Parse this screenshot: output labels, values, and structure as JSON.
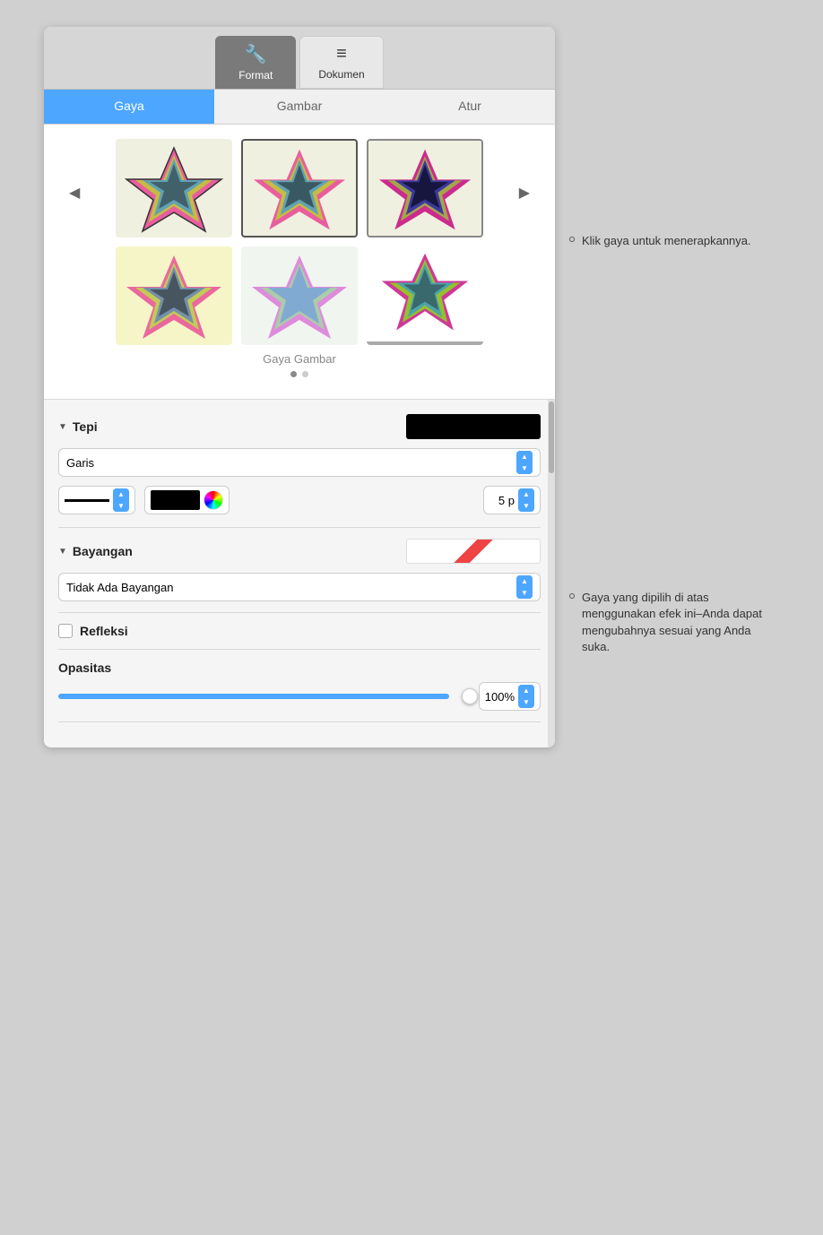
{
  "toolbar": {
    "format_label": "Format",
    "dokumen_label": "Dokumen",
    "format_icon": "🔧",
    "dokumen_icon": "≡"
  },
  "tabs": {
    "gaya_label": "Gaya",
    "gambar_label": "Gambar",
    "atur_label": "Atur"
  },
  "styles": {
    "section_label": "Gaya Gambar",
    "page_dot1_active": true,
    "page_dot2_active": false
  },
  "tepi": {
    "title": "Tepi",
    "border_type_label": "Garis",
    "size_value": "5 p"
  },
  "bayangan": {
    "title": "Bayangan",
    "type_label": "Tidak Ada Bayangan"
  },
  "refleksi": {
    "label": "Refleksi",
    "checked": false
  },
  "opasitas": {
    "title": "Opasitas",
    "value": "100%",
    "percent": 100
  },
  "callouts": {
    "callout1_text": "Klik gaya untuk menerapkannya.",
    "callout2_text": "Gaya yang dipilih di atas menggunakan efek ini–Anda dapat mengubahnya sesuai yang Anda suka."
  }
}
